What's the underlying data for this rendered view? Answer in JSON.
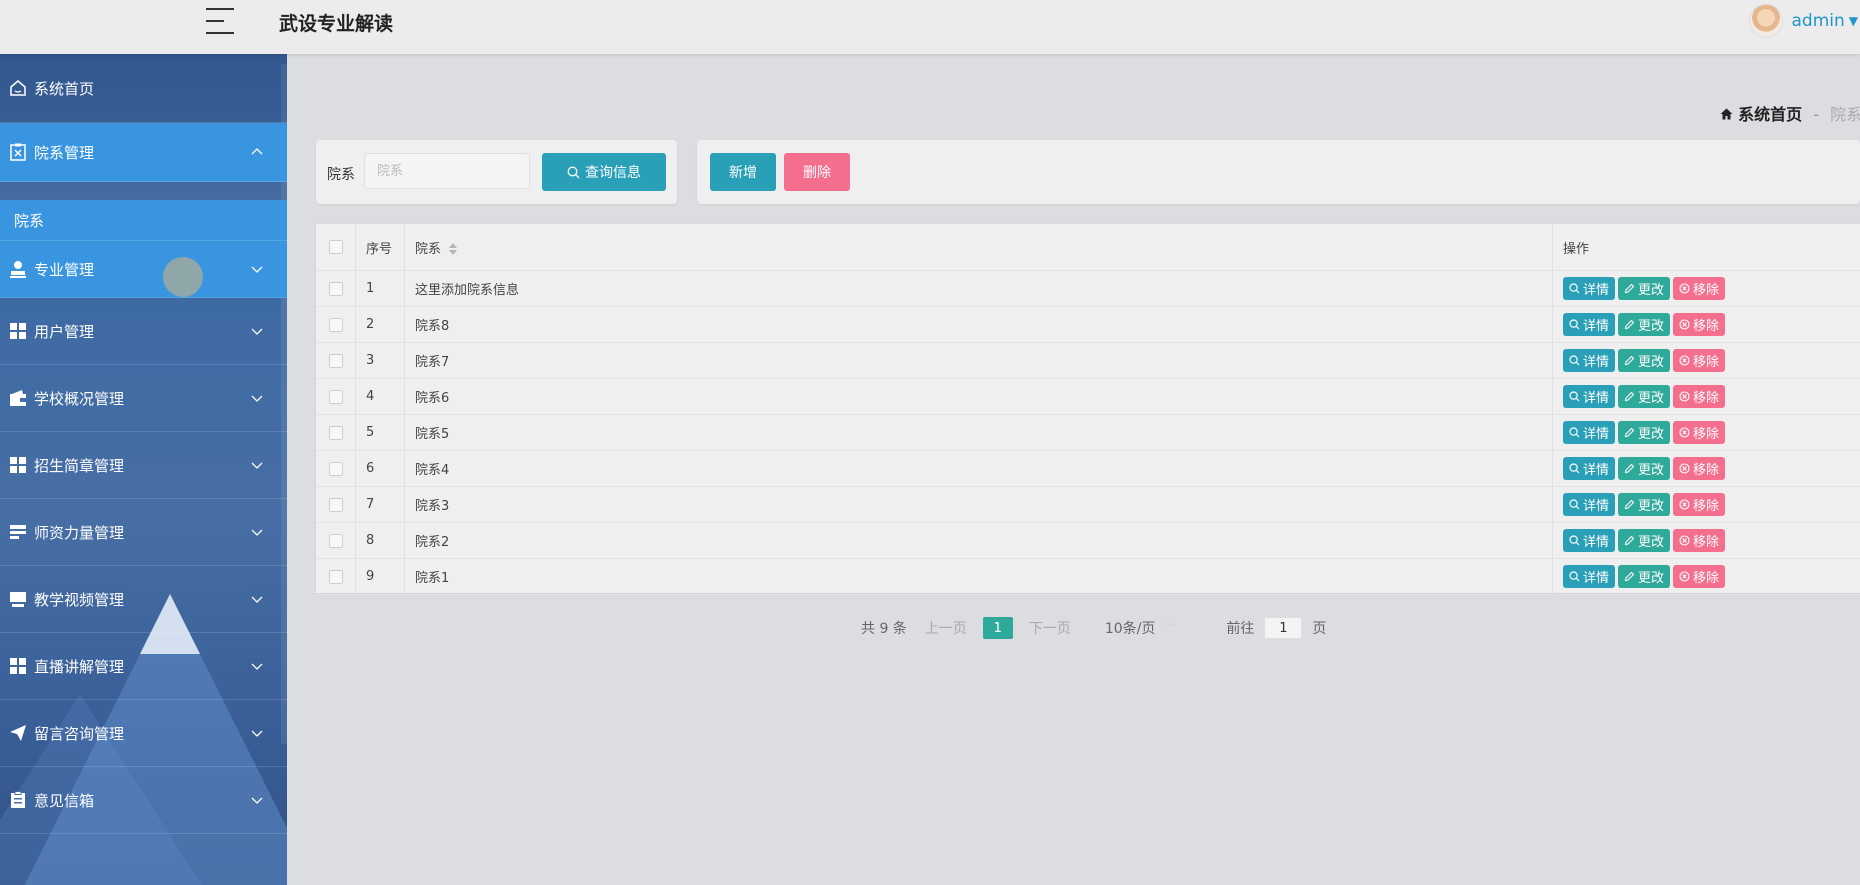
{
  "header": {
    "title": "武设专业解读",
    "username": "admin"
  },
  "sidebar": {
    "items": [
      {
        "label": "系统首页",
        "icon": "home-icon"
      },
      {
        "label": "院系管理",
        "icon": "clipboard-x-icon",
        "expanded": true,
        "children": [
          "院系"
        ]
      },
      {
        "label": "专业管理",
        "icon": "user-stamp-icon"
      },
      {
        "label": "用户管理",
        "icon": "grid-icon"
      },
      {
        "label": "学校概况管理",
        "icon": "wallet-icon"
      },
      {
        "label": "招生简章管理",
        "icon": "grid-icon"
      },
      {
        "label": "师资力量管理",
        "icon": "list-bars-icon"
      },
      {
        "label": "教学视频管理",
        "icon": "video-icon"
      },
      {
        "label": "直播讲解管理",
        "icon": "grid-icon"
      },
      {
        "label": "留言咨询管理",
        "icon": "paper-plane-icon"
      },
      {
        "label": "意见信箱",
        "icon": "clipboard-icon"
      }
    ]
  },
  "breadcrumb": {
    "home": "系统首页",
    "separator": "-",
    "current": "院系"
  },
  "search": {
    "label": "院系",
    "placeholder": "院系",
    "value": "",
    "button": "查询信息"
  },
  "actions": {
    "add": "新增",
    "delete": "删除"
  },
  "table": {
    "headers": {
      "index": "序号",
      "name": "院系",
      "ops": "操作"
    },
    "rows": [
      {
        "index": "1",
        "name": "这里添加院系信息"
      },
      {
        "index": "2",
        "name": "院系8"
      },
      {
        "index": "3",
        "name": "院系7"
      },
      {
        "index": "4",
        "name": "院系6"
      },
      {
        "index": "5",
        "name": "院系5"
      },
      {
        "index": "6",
        "name": "院系4"
      },
      {
        "index": "7",
        "name": "院系3"
      },
      {
        "index": "8",
        "name": "院系2"
      },
      {
        "index": "9",
        "name": "院系1"
      }
    ],
    "ops": {
      "detail": "详情",
      "edit": "更改",
      "remove": "移除"
    }
  },
  "pagination": {
    "total": "共 9 条",
    "prev": "上一页",
    "page": "1",
    "next": "下一页",
    "page_size": "10条/页",
    "goto_label": "前往",
    "goto_value": "1",
    "goto_suffix": "页"
  },
  "colors": {
    "accent": "#2a9fb8",
    "edit": "#2faa9a",
    "danger": "#f46f8e",
    "sidebar_active": "#3a95e0"
  }
}
